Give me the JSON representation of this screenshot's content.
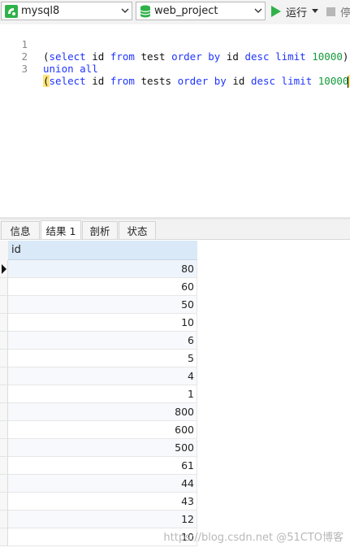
{
  "toolbar": {
    "connection": {
      "label": "mysql8",
      "icon": "connection-icon"
    },
    "database": {
      "label": "web_project",
      "icon": "database-icon"
    },
    "run_label": "运行",
    "stop_label": "停"
  },
  "editor": {
    "line_numbers": [
      "1",
      "2",
      "3"
    ],
    "lines": [
      "(select id from test order by id desc limit 10000)",
      "union all",
      "(select id from tests order by id desc limit 10000)"
    ]
  },
  "tabs": [
    "信息",
    "结果 1",
    "剖析",
    "状态"
  ],
  "active_tab": "结果 1",
  "grid": {
    "column": "id",
    "rows": [
      "80",
      "60",
      "50",
      "10",
      "6",
      "5",
      "4",
      "1",
      "800",
      "600",
      "500",
      "61",
      "44",
      "43",
      "12",
      "10"
    ]
  },
  "watermark": "https://blog.csdn.net @51CTO博客",
  "colors": {
    "keyword": "#1f35ff",
    "number": "#139b3a",
    "header_bg": "#d9e9f7",
    "run_icon": "#2fb24a"
  }
}
